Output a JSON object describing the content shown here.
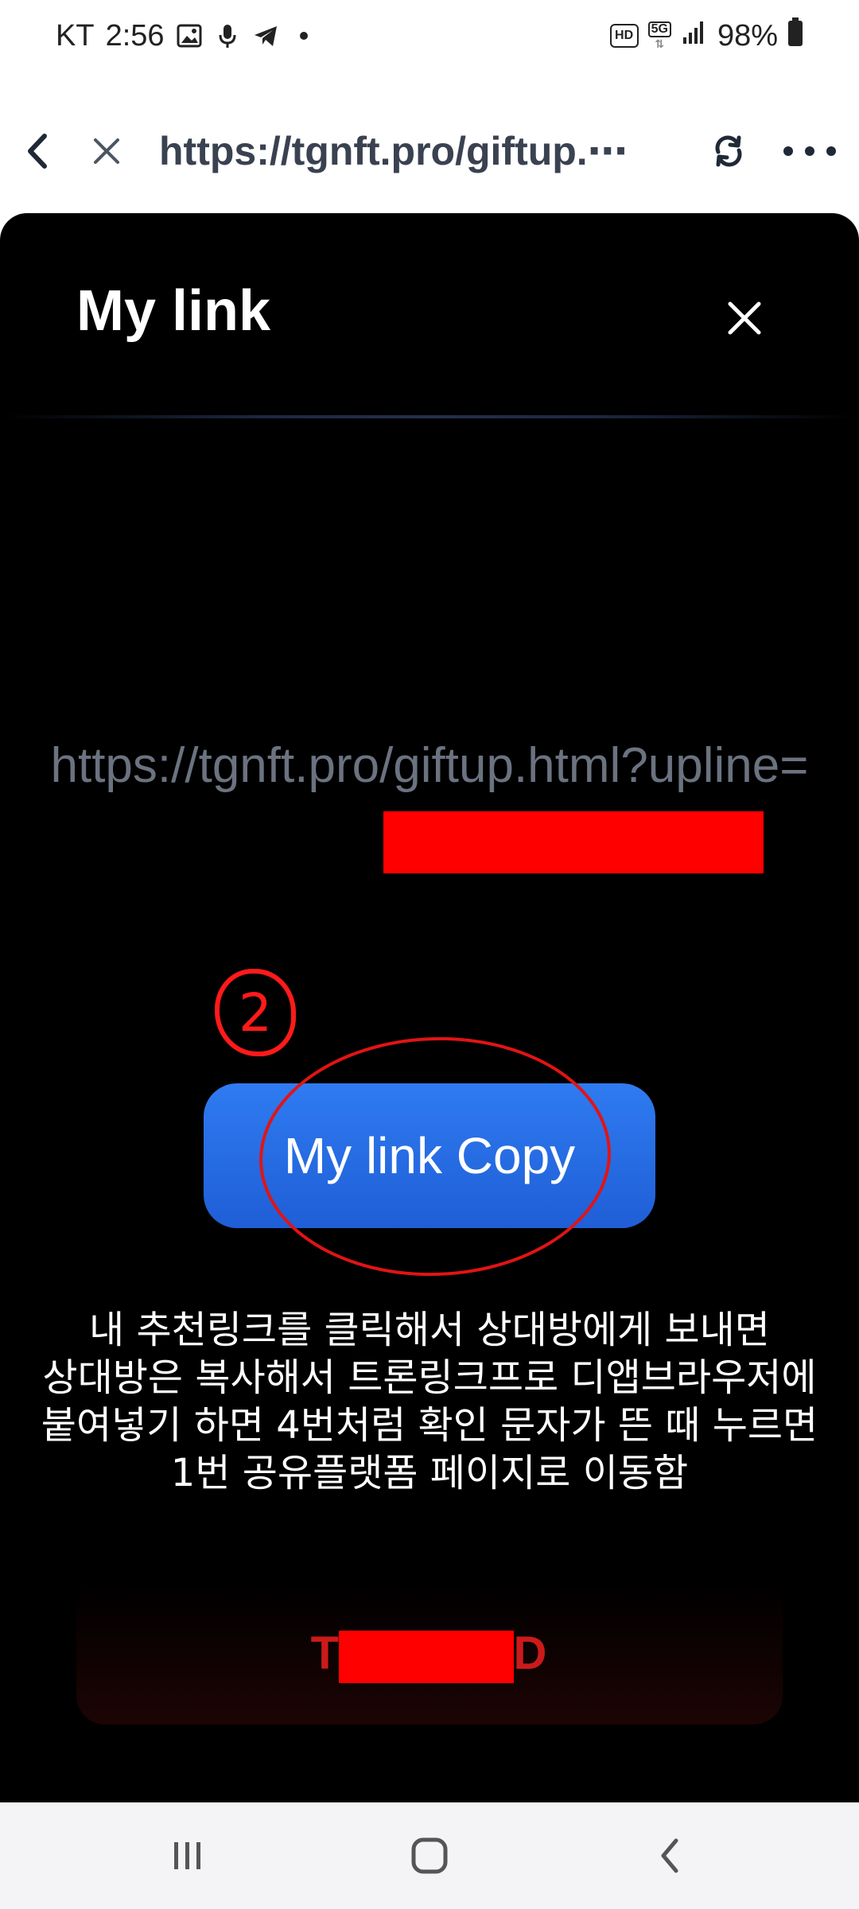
{
  "status_bar": {
    "carrier": "KT",
    "time": "2:56",
    "network": "5G",
    "hd_label": "HD",
    "battery": "98%"
  },
  "browser": {
    "url": "https://tgnft.pro/giftup.⋯"
  },
  "modal": {
    "title": "My link",
    "link_text": "https://tgnft.pro/giftup.html?upline=T",
    "annotation_number": "2",
    "copy_button_label": "My link Copy",
    "description_lines": [
      "내 추천링크를 클릭해서 상대방에게 보내면",
      "상대방은 복사해서 트론링크프로 디앱브라우저에",
      "붙여넣기 하면 4번처럼 확인 문자가 뜬 때 누르면",
      "1번 공유플랫폼 페이지로 이동함"
    ],
    "bottom_card_label": "T            D"
  },
  "colors": {
    "accent_blue": "#2f7bf1",
    "annotation_red": "#e11414",
    "redaction_red": "#ff0000",
    "bottom_label_red": "#cc1a1a"
  }
}
